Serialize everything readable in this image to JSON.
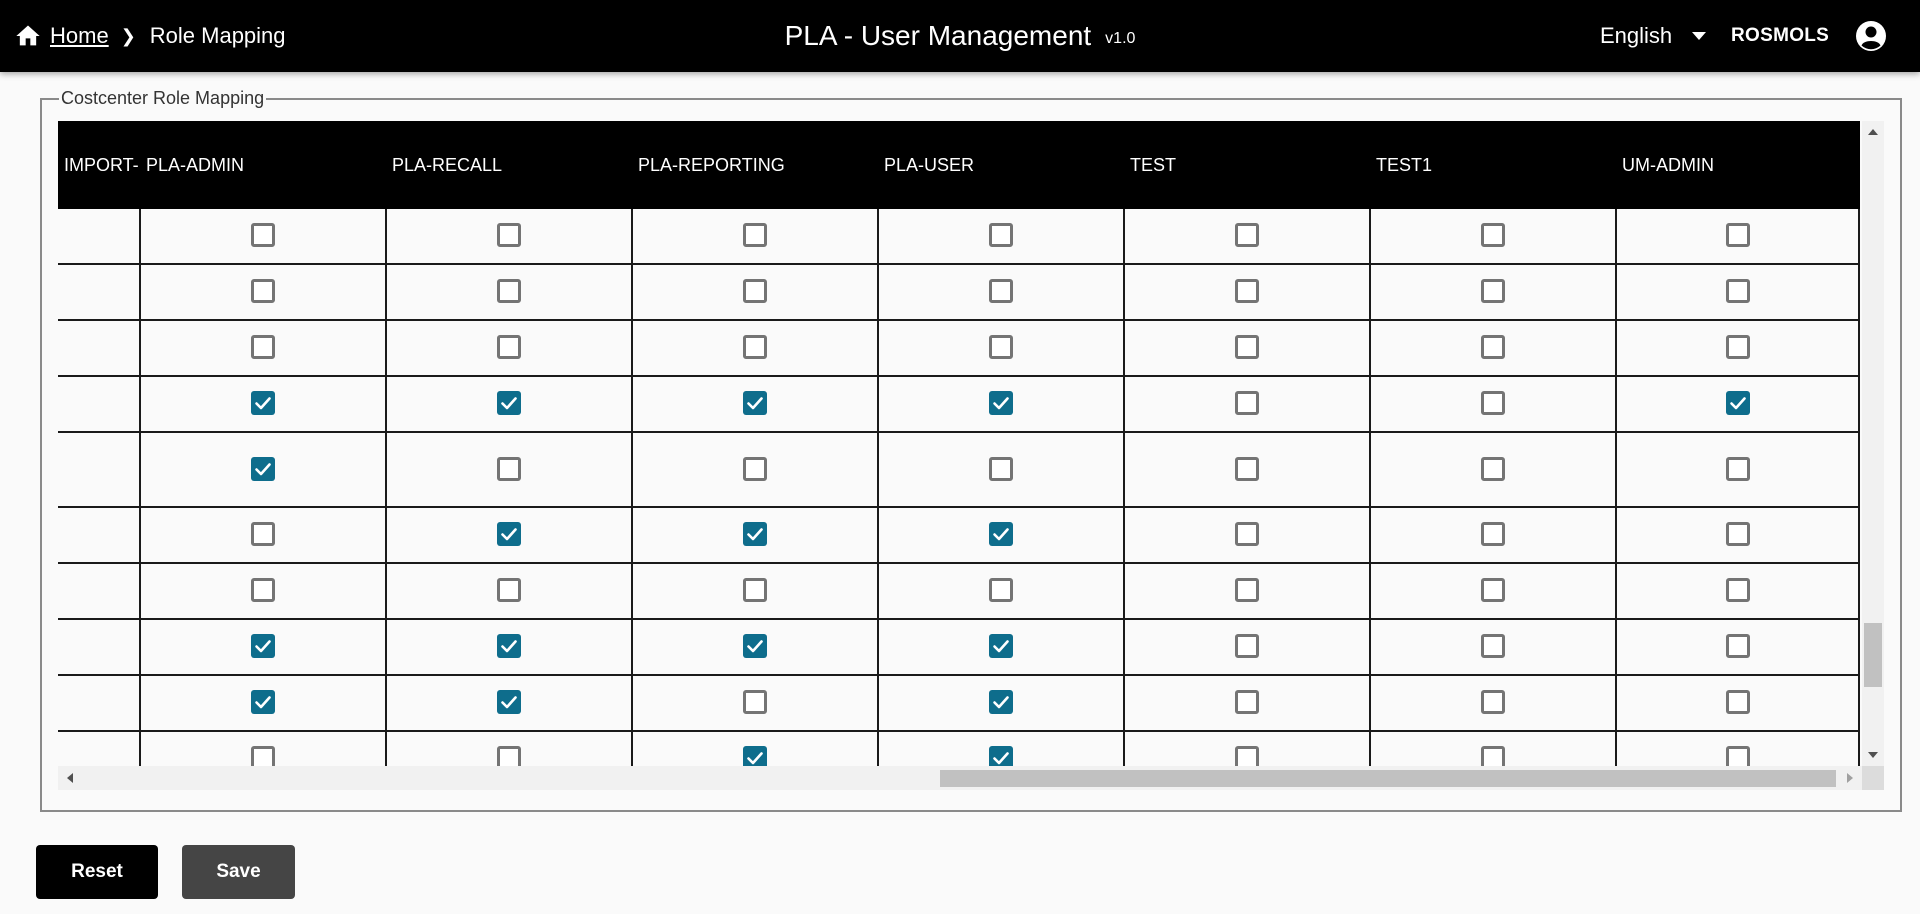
{
  "header": {
    "home_label": "Home",
    "breadcrumb_current": "Role Mapping",
    "app_title": "PLA - User Management",
    "version": "v1.0",
    "language": "English",
    "username": "ROSMOLS"
  },
  "section": {
    "legend": "Costcenter Role Mapping"
  },
  "grid": {
    "columns": [
      "IMPORT-I",
      "PLA-ADMIN",
      "PLA-RECALL",
      "PLA-REPORTING",
      "PLA-USER",
      "TEST",
      "TEST1",
      "UM-ADMIN"
    ],
    "rows": [
      [
        false,
        false,
        false,
        false,
        false,
        false,
        false
      ],
      [
        false,
        false,
        false,
        false,
        false,
        false,
        false
      ],
      [
        false,
        false,
        false,
        false,
        false,
        false,
        false
      ],
      [
        true,
        true,
        true,
        true,
        false,
        false,
        true
      ],
      [
        true,
        false,
        false,
        false,
        false,
        false,
        false
      ],
      [
        false,
        true,
        true,
        true,
        false,
        false,
        false
      ],
      [
        false,
        false,
        false,
        false,
        false,
        false,
        false
      ],
      [
        true,
        true,
        true,
        true,
        false,
        false,
        false
      ],
      [
        true,
        true,
        false,
        true,
        false,
        false,
        false
      ],
      [
        false,
        false,
        true,
        true,
        false,
        false,
        false
      ]
    ]
  },
  "colors": {
    "header_bg": "#000000",
    "checkbox_checked": "#0e6d8c",
    "checkbox_border": "#747474"
  },
  "actions": {
    "reset_label": "Reset",
    "save_label": "Save"
  }
}
